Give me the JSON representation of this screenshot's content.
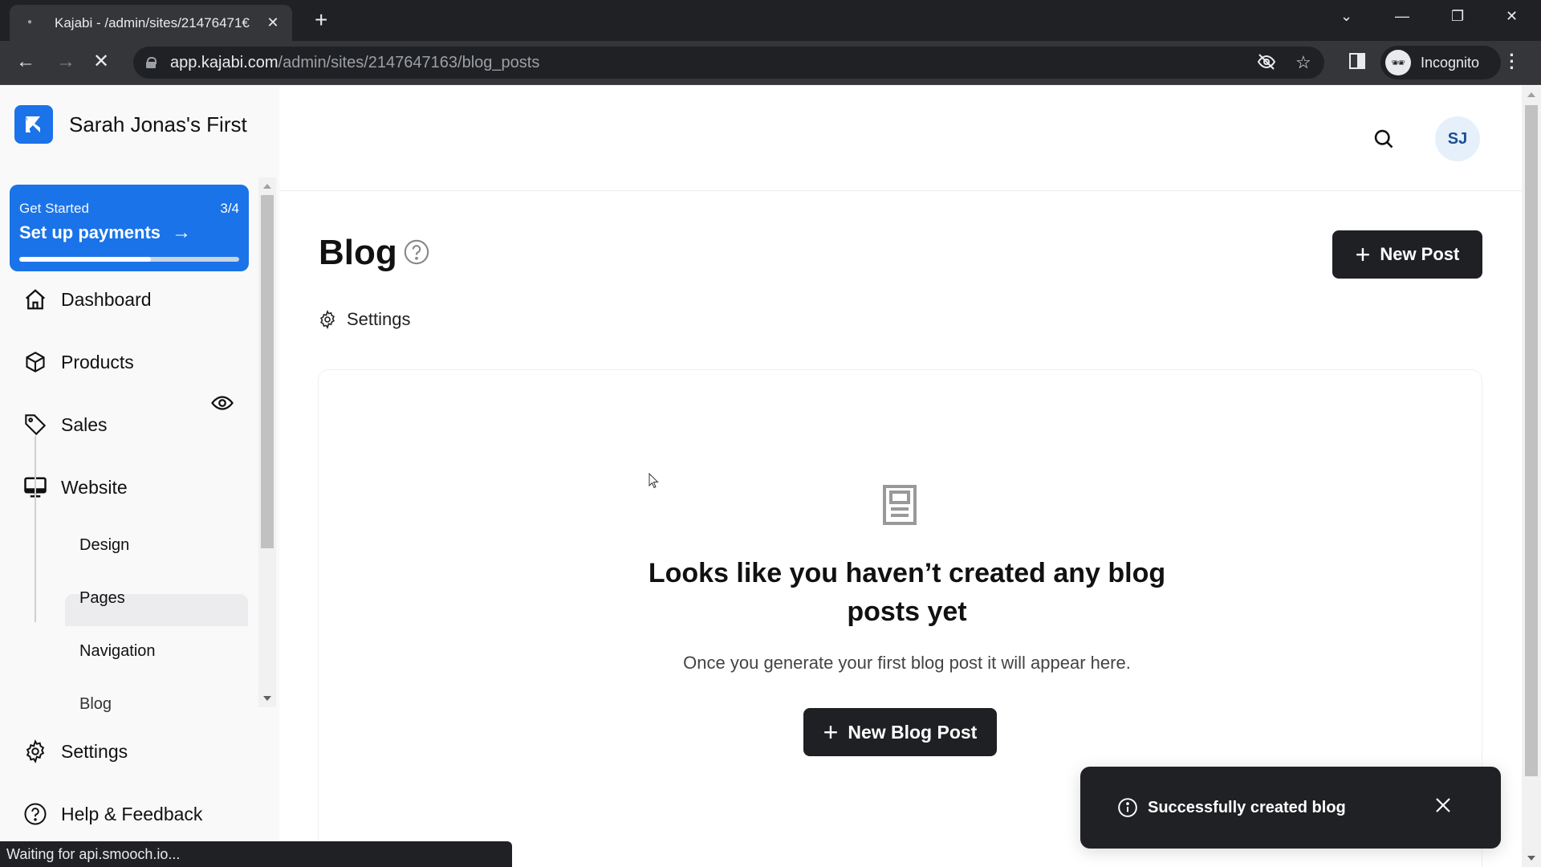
{
  "browser": {
    "tab_title": "Kajabi - /admin/sites/2147647163/blog_posts",
    "tab_title_visible": "Kajabi - /admin/sites/21476471€",
    "url_host": "app.kajabi.com",
    "url_path": "/admin/sites/2147647163/blog_posts",
    "profile_label": "Incognito",
    "status_text": "Waiting for api.smooch.io..."
  },
  "sidebar": {
    "site_name": "Sarah Jonas's First",
    "get_started": {
      "label": "Get Started",
      "progress_text": "3/4",
      "progress_fraction": 0.6,
      "cta": "Set up payments"
    },
    "items": [
      {
        "label": "Dashboard",
        "icon": "home-icon"
      },
      {
        "label": "Products",
        "icon": "box-icon"
      },
      {
        "label": "Sales",
        "icon": "tag-icon"
      },
      {
        "label": "Website",
        "icon": "monitor-icon"
      }
    ],
    "website_subitems": [
      {
        "label": "Design"
      },
      {
        "label": "Pages"
      },
      {
        "label": "Navigation"
      },
      {
        "label": "Blog",
        "active": true
      }
    ],
    "bottom_items": [
      {
        "label": "Settings",
        "icon": "gear-icon"
      },
      {
        "label": "Help & Feedback",
        "icon": "help-circle-icon"
      }
    ]
  },
  "header": {
    "avatar_initials": "SJ"
  },
  "main": {
    "title": "Blog",
    "settings_label": "Settings",
    "new_post_label": "New Post",
    "empty_state": {
      "title": "Looks like you haven’t created any blog posts yet",
      "description": "Once you generate your first blog post it will appear here.",
      "button_label": "New Blog Post"
    }
  },
  "toast": {
    "message": "Successfully created blog"
  },
  "colors": {
    "brand_blue": "#1a73e8",
    "dark_button": "#1f2023",
    "avatar_bg": "#e6f0fb",
    "avatar_text": "#1d4f91"
  }
}
